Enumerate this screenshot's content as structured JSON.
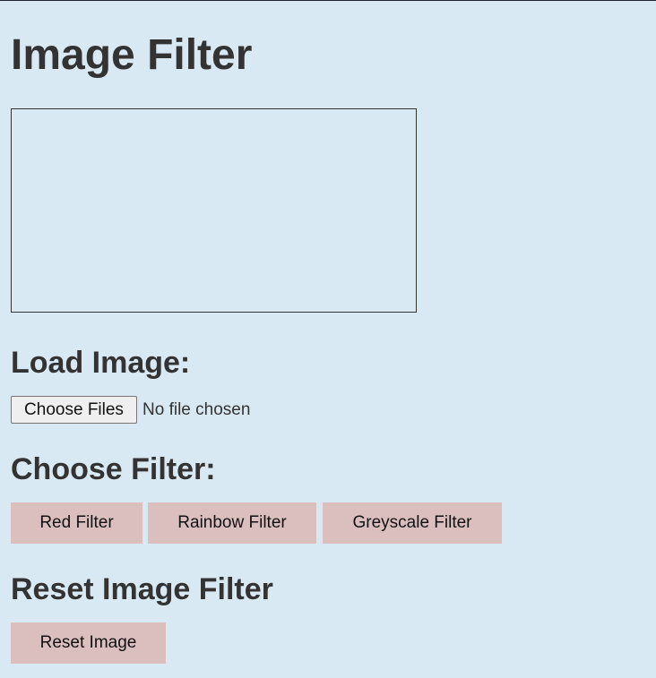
{
  "title": "Image Filter",
  "load": {
    "heading": "Load Image:",
    "button_label": "Choose Files",
    "status": "No file chosen"
  },
  "filters": {
    "heading": "Choose Filter:",
    "buttons": [
      "Red Filter",
      "Rainbow Filter",
      "Greyscale Filter"
    ]
  },
  "reset": {
    "heading": "Reset Image Filter",
    "button_label": "Reset Image"
  },
  "colors": {
    "background": "#d9e9f3",
    "button": "#dbbfbf",
    "text": "#333333"
  }
}
